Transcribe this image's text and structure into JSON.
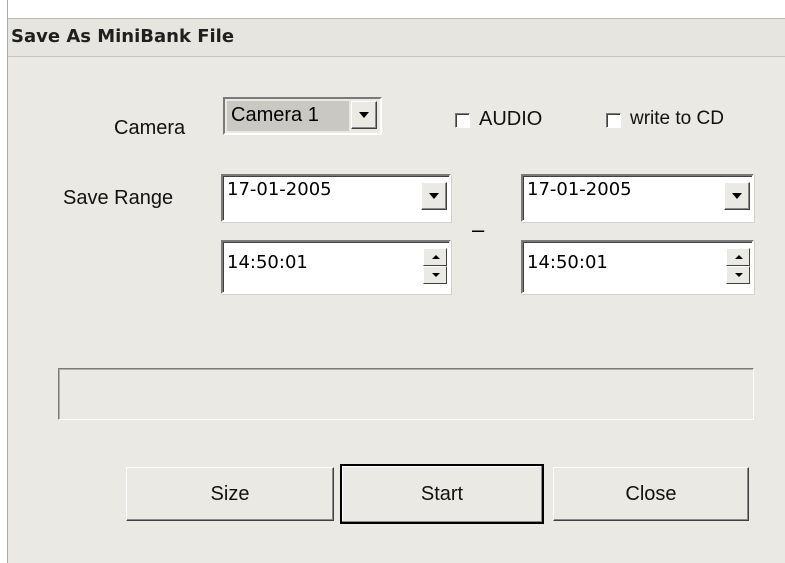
{
  "window": {
    "title": "Save As MiniBank File"
  },
  "camera": {
    "label": "Camera",
    "selected": "Camera 1"
  },
  "options": {
    "audio_label": "AUDIO",
    "audio_checked": false,
    "cd_label": "write to CD",
    "cd_checked": false
  },
  "save_range": {
    "label": "Save Range",
    "separator": "–",
    "start_date": "17-01-2005",
    "end_date": "17-01-2005",
    "start_time": "14:50:01",
    "end_time": "14:50:01"
  },
  "progress": {
    "value": 0
  },
  "buttons": {
    "size": "Size",
    "start": "Start",
    "close": "Close"
  }
}
